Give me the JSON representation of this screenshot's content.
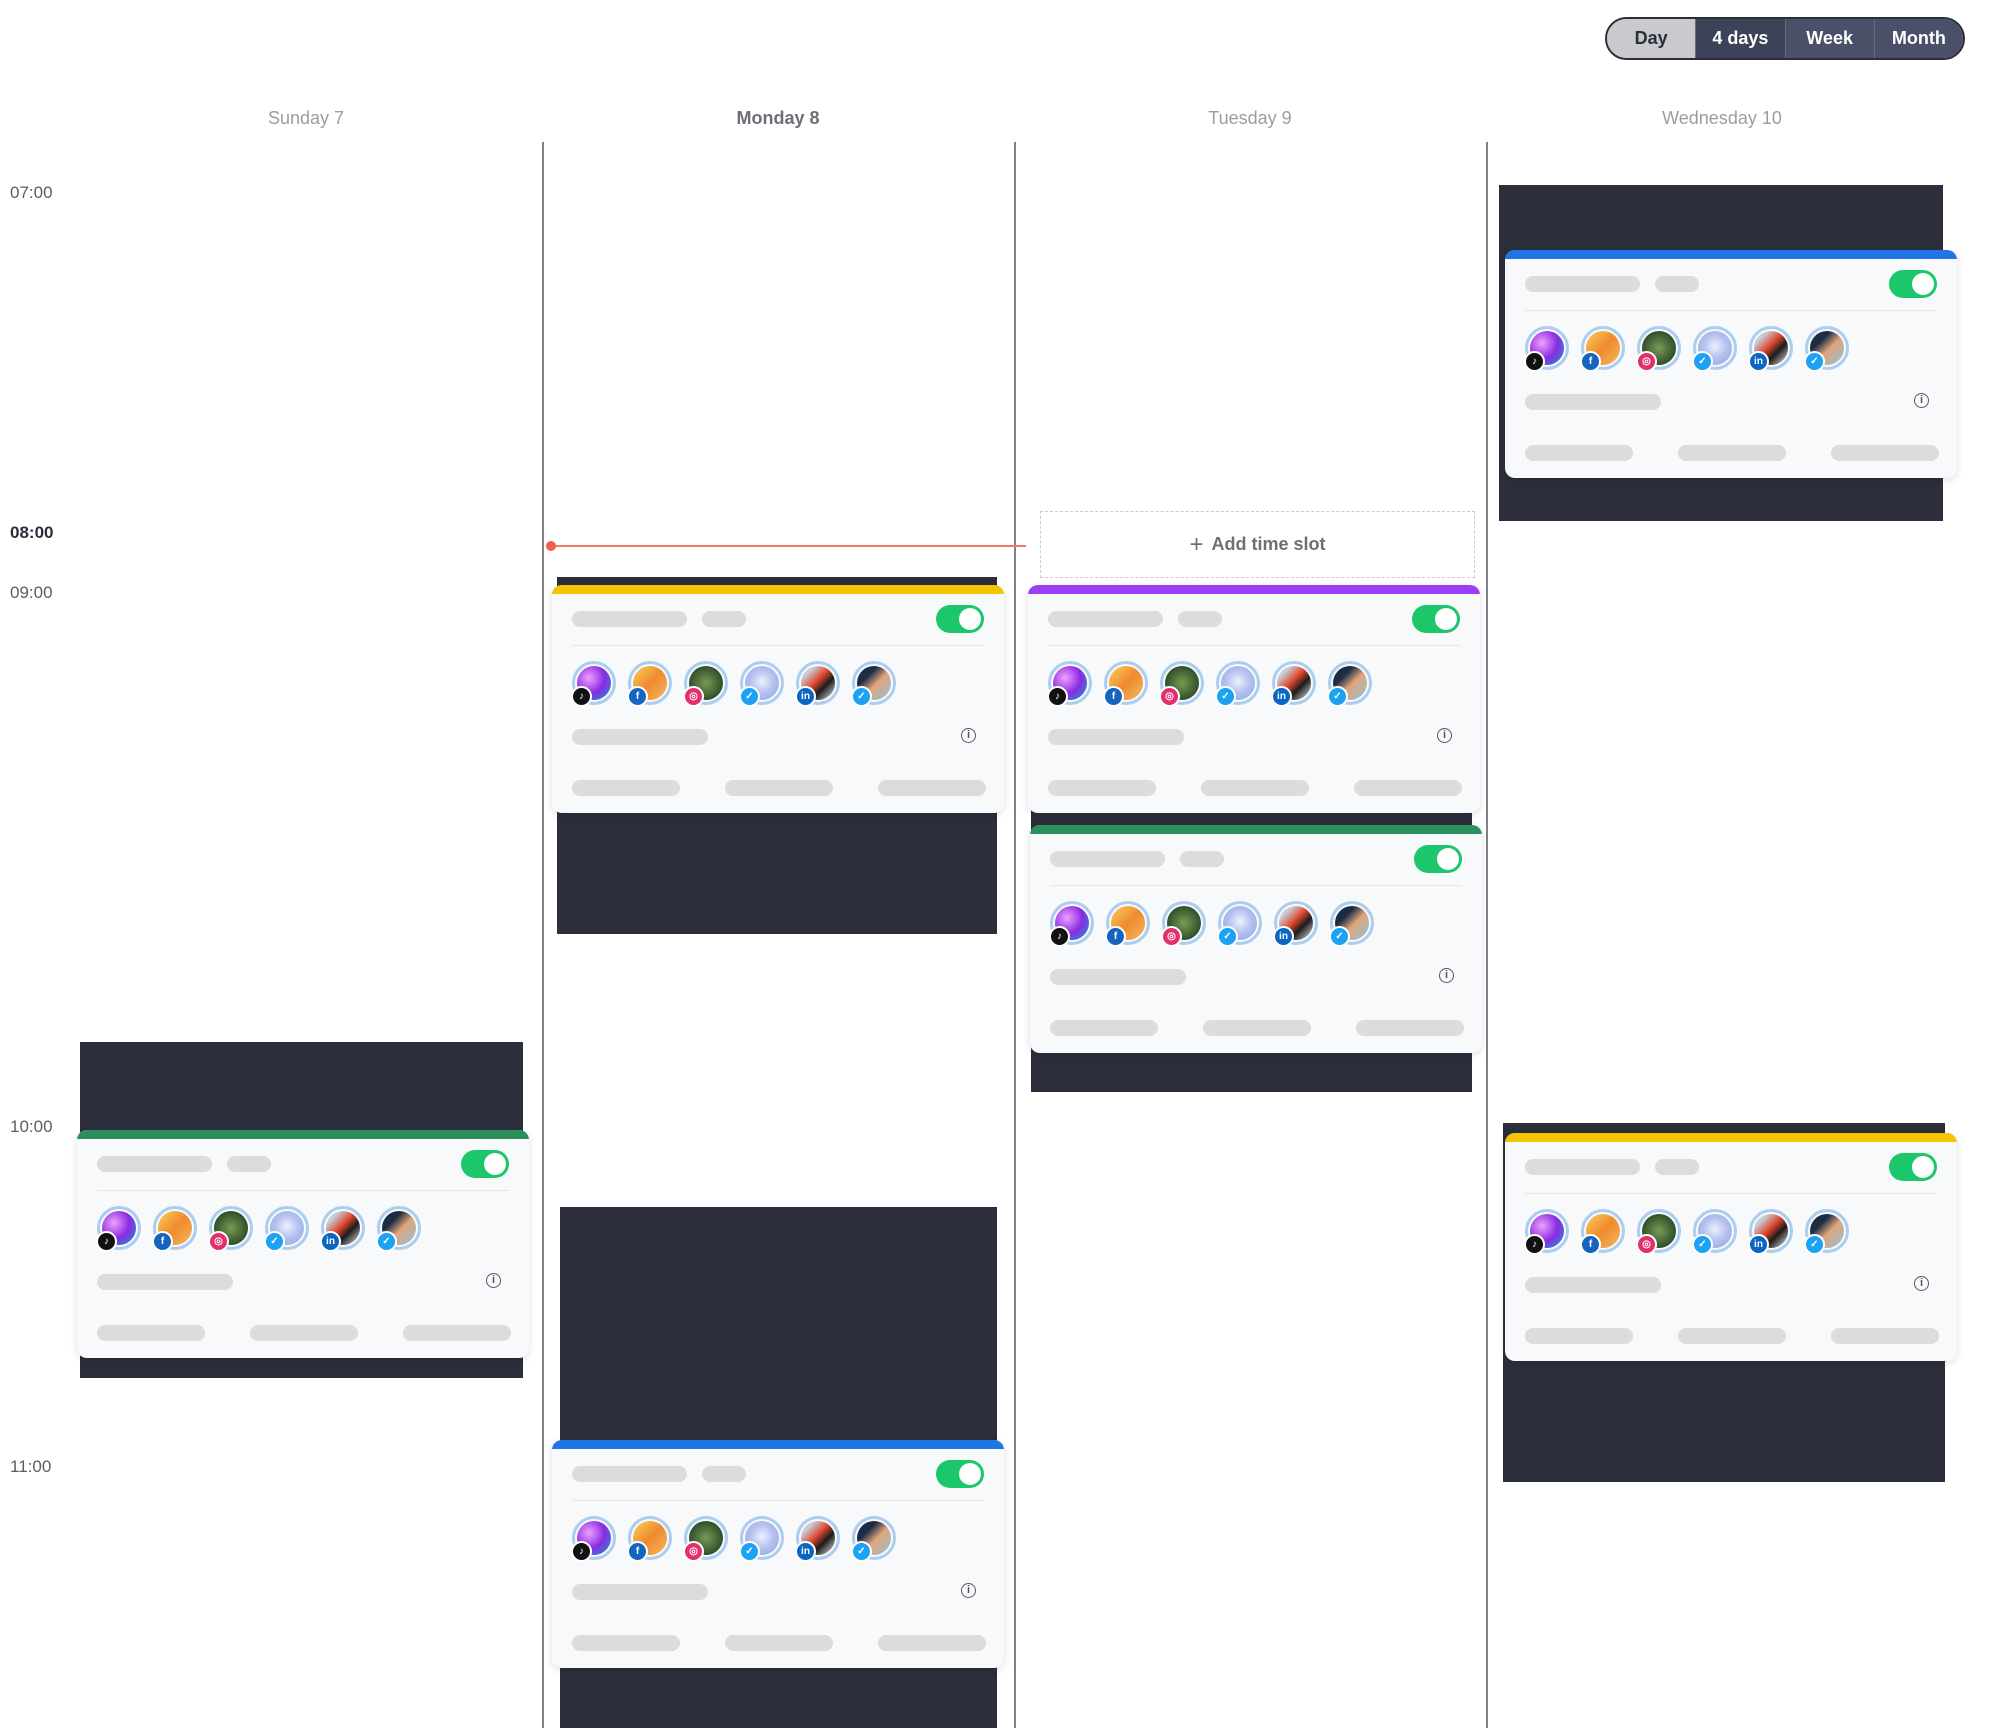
{
  "view_switch": {
    "options": [
      "Day",
      "4 days",
      "Week",
      "Month"
    ],
    "selected": "4 days"
  },
  "days": [
    "Sunday 7",
    "Monday 8",
    "Tuesday 9",
    "Wednesday 10"
  ],
  "highlight_day": "Monday 8",
  "times": [
    "07:00",
    "08:00",
    "09:00",
    "10:00",
    "11:00"
  ],
  "current_time": "08:00",
  "add_slot_label": "Add time slot",
  "colors": {
    "toggle_on": "#1cc76b",
    "yellow": "#f5c400",
    "purple": "#9b3ff5",
    "green": "#2b8f5e",
    "blue": "#1f74e8",
    "now_line": "#f07a66",
    "dark_block": "#2c2f3b"
  },
  "cards": [
    {
      "day": "Sunday 7",
      "accent": "green",
      "toggle": "on"
    },
    {
      "day": "Monday 8",
      "accent": "yellow",
      "toggle": "on"
    },
    {
      "day": "Monday 8",
      "accent": "blue",
      "toggle": "on"
    },
    {
      "day": "Tuesday 9",
      "accent": "purple",
      "toggle": "on"
    },
    {
      "day": "Tuesday 9",
      "accent": "green",
      "toggle": "on"
    },
    {
      "day": "Wednesday 10",
      "accent": "blue",
      "toggle": "on"
    },
    {
      "day": "Wednesday 10",
      "accent": "yellow",
      "toggle": "on"
    }
  ],
  "avatar_badges": [
    {
      "network": "tiktok-icon",
      "glyph": "♪",
      "color": "#111111"
    },
    {
      "network": "facebook-icon",
      "glyph": "f",
      "color": "#1565c0"
    },
    {
      "network": "instagram-icon",
      "glyph": "◎",
      "color": "#e1306c"
    },
    {
      "network": "twitter-icon",
      "glyph": "✓",
      "color": "#1da1f2"
    },
    {
      "network": "linkedin-icon",
      "glyph": "in",
      "color": "#0a66c2"
    },
    {
      "network": "twitter-icon",
      "glyph": "✓",
      "color": "#1da1f2"
    }
  ]
}
